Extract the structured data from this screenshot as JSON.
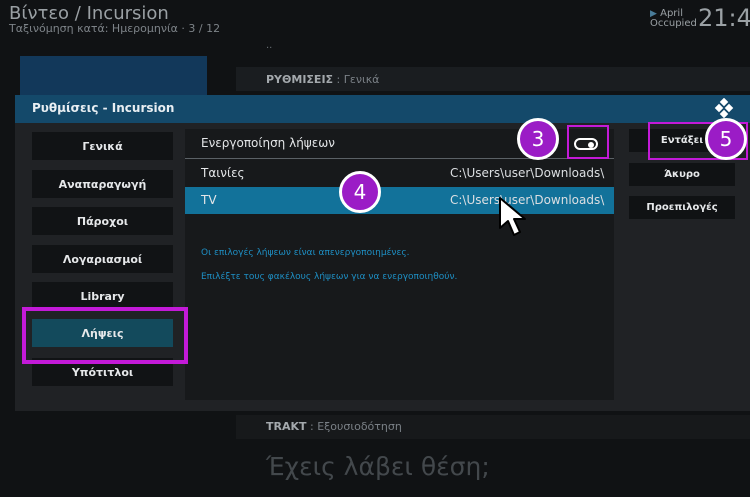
{
  "background": {
    "title": "Βίντεο / Incursion",
    "subtitle": "Ταξινόμηση κατά: Ημερομηνία  ·  3 / 12",
    "clock": "21:4",
    "date_line1": "April",
    "date_line2": "Occupied",
    "dots": "..",
    "line1_bold": "ΡΥΘΜΙΣΕΙΣ",
    "line1_rest": " : Γενικά",
    "line2_bold": "TRAKT",
    "line2_rest": " : Εξουσιοδότηση",
    "big_text": "Έχεις λάβει θέση;"
  },
  "dialog": {
    "title": "Ρυθμίσεις - Incursion",
    "categories": [
      "Γενικά",
      "Αναπαραγωγή",
      "Πάροχοι",
      "Λογαριασμοί",
      "Library",
      "Λήψεις",
      "Υπότιτλοι"
    ],
    "active_category": "Λήψεις",
    "options": [
      {
        "label": "Ενεργοποίηση λήψεων",
        "value": ""
      },
      {
        "label": "Ταινίες",
        "value": "C:\\Users\\user\\Downloads\\"
      },
      {
        "label": "TV",
        "value": "C:\\Users\\user\\Downloads\\"
      }
    ],
    "toggle_state": "on",
    "info_line1": "Οι επιλογές λήψεων είναι απενεργοποιημένες.",
    "info_line2": "Επιλέξτε τους φακέλους λήψεων για να ενεργοποιηθούν.",
    "buttons": {
      "ok": "Εντάξει",
      "cancel": "Άκυρο",
      "defaults": "Προεπιλογές"
    }
  },
  "annotations": {
    "marker3": "3",
    "marker4": "4",
    "marker5": "5"
  },
  "colors": {
    "accent": "#12729a",
    "header": "#14496a",
    "annotation": "#c31ad8"
  }
}
